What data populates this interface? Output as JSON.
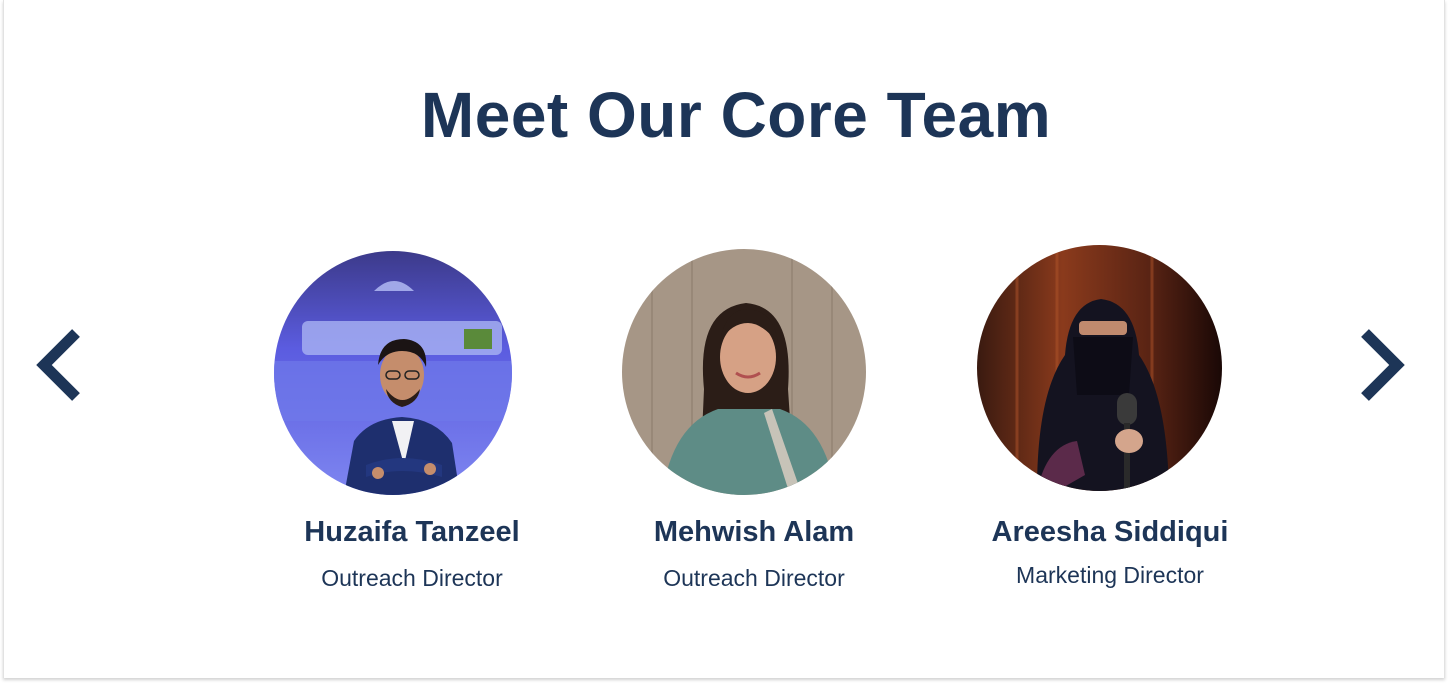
{
  "section": {
    "title": "Meet Our Core Team"
  },
  "carousel": {
    "prev_icon": "chevron-left-icon",
    "next_icon": "chevron-right-icon",
    "accent_color": "#1d3557"
  },
  "members": [
    {
      "name": "Huzaifa Tanzeel",
      "role": "Outreach Director"
    },
    {
      "name": "Mehwish Alam",
      "role": "Outreach Director"
    },
    {
      "name": "Areesha Siddiqui",
      "role": "Marketing Director"
    }
  ]
}
